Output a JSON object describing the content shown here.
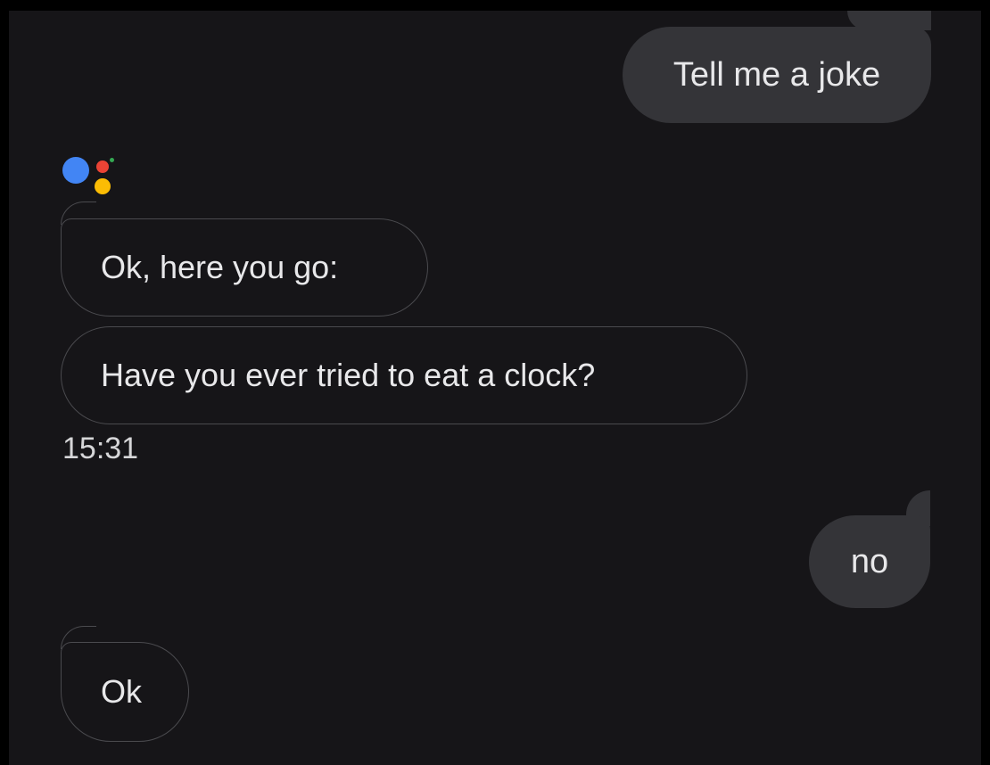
{
  "conversation": {
    "messages": [
      {
        "sender": "user",
        "text": "Tell me a joke"
      },
      {
        "sender": "assistant",
        "text": "Ok, here you go:"
      },
      {
        "sender": "assistant",
        "text": "Have you ever tried to eat a clock?"
      },
      {
        "sender": "user",
        "text": "no"
      },
      {
        "sender": "assistant",
        "text": "Ok"
      }
    ],
    "timestamp": "15:31"
  },
  "assistant_logo": {
    "icon": "google-assistant-icon",
    "colors": {
      "blue": "#4285F4",
      "red": "#EA4335",
      "yellow": "#FBBC04",
      "green": "#34A853"
    }
  },
  "theme": {
    "background": "#161518",
    "user_bubble": "#343438",
    "assistant_outline": "#4a4a4e",
    "text": "#e8e8ea"
  }
}
